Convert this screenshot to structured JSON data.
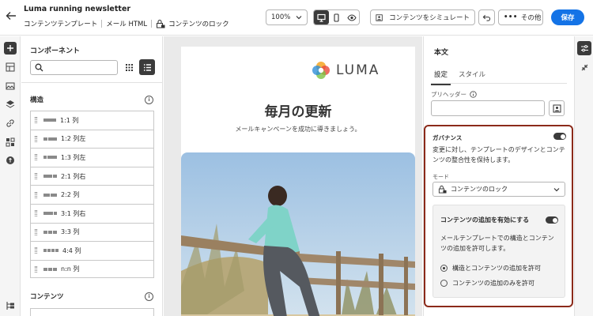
{
  "header": {
    "title": "Luma running newsletter",
    "breadcrumbs": [
      "コンテンツテンプレート",
      "メール HTML"
    ],
    "lock_label": "コンテンツのロック",
    "zoom": "100%",
    "simulate_label": "コンテンツをシミュレート",
    "more_label": "その他",
    "save_label": "保存"
  },
  "left_panel": {
    "title": "コンポーネント",
    "search_placeholder": "",
    "structure_heading": "構造",
    "structure_items": [
      {
        "label": "1:1 列",
        "cols": [
          1
        ]
      },
      {
        "label": "1:2 列左",
        "cols": [
          1,
          2
        ]
      },
      {
        "label": "1:3 列左",
        "cols": [
          1,
          3
        ]
      },
      {
        "label": "2:1 列右",
        "cols": [
          2,
          1
        ]
      },
      {
        "label": "2:2 列",
        "cols": [
          1,
          1
        ]
      },
      {
        "label": "3:1 列右",
        "cols": [
          3,
          1
        ]
      },
      {
        "label": "3:3 列",
        "cols": [
          1,
          1,
          1
        ]
      },
      {
        "label": "4:4 列",
        "cols": [
          1,
          1,
          1,
          1
        ]
      },
      {
        "label": "n:n 列",
        "cols": [
          1,
          1,
          1
        ]
      }
    ],
    "content_heading": "コンテンツ"
  },
  "email": {
    "logo_text": "LUMA",
    "headline": "毎月の更新",
    "subheadline": "メールキャンペーンを成功に導きましょう。"
  },
  "right_panel": {
    "title": "本文",
    "tabs": [
      "設定",
      "スタイル"
    ],
    "preheader_label": "プリヘッダー",
    "governance_title": "ガバナンス",
    "governance_desc": "変更に対し、テンプレートのデザインとコンテンツの整合性を保持します。",
    "mode_label": "モード",
    "mode_value": "コンテンツのロック",
    "add_content_title": "コンテンツの追加を有効にする",
    "add_content_desc": "メールテンプレートでの構造とコンテンツの追加を許可します。",
    "radio_options": [
      "構造とコンテンツの追加を許可",
      "コンテンツの追加のみを許可"
    ]
  },
  "colors": {
    "accent": "#1473e6",
    "governance_border": "#8b2a1a",
    "dark": "#3b3b3b"
  }
}
